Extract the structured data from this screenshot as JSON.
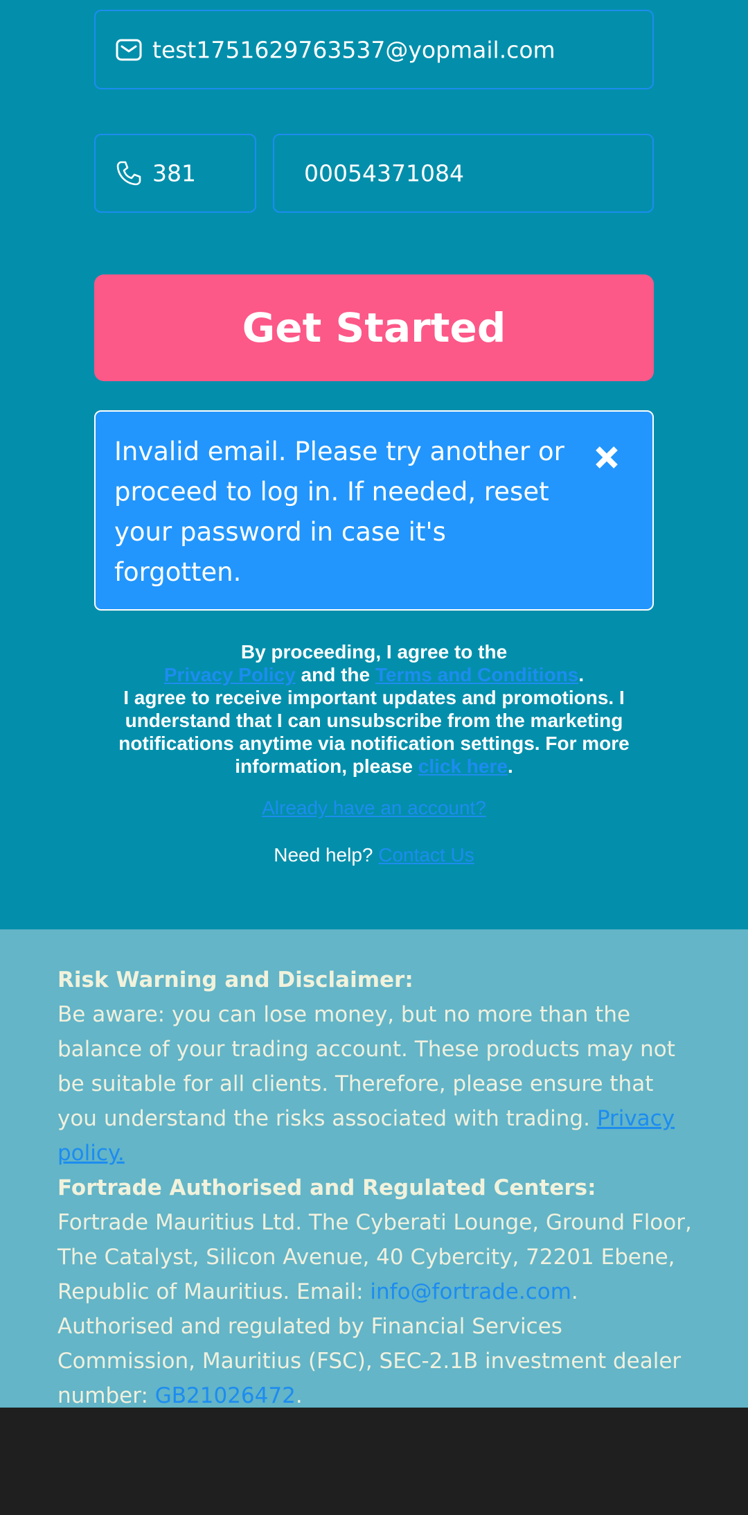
{
  "form": {
    "email_value": "test1751629763537@yopmail.com",
    "country_code": "381",
    "phone_value": "00054371084",
    "submit_label": "Get Started"
  },
  "error": {
    "message": "Invalid email. Please try another or proceed to log in. If needed, reset your password in case it's forgotten."
  },
  "legal": {
    "line1": "By proceeding, I agree to the",
    "privacy_link": "Privacy Policy",
    "and_the": "and the",
    "terms_link": "Terms and Conditions",
    "period": ".",
    "consent": "I agree to receive important updates and promotions. I understand that I can unsubscribe from the marketing notifications anytime via notification settings. For more information, please",
    "click_here": "click here"
  },
  "links": {
    "already_account": "Already have an account?",
    "need_help": "Need help?",
    "contact_us": "Contact Us"
  },
  "footer": {
    "risk_title": "Risk Warning and Disclaimer:",
    "risk_text": "Be aware: you can lose money, but no more than the balance of your trading account. These products may not be suitable for all clients. Therefore, please ensure that you understand the risks associated with trading.",
    "privacy_link": "Privacy policy.",
    "centers_title": "Fortrade Authorised and Regulated Centers:",
    "centers_text": "Fortrade Mauritius Ltd. The Cyberati Lounge, Ground Floor, The Catalyst, Silicon Avenue, 40 Cybercity, 72201 Ebene, Republic of Mauritius. Email:",
    "email": "info@fortrade.com",
    "authorised_text": "Authorised and regulated by Financial Services Commission, Mauritius (FSC), SEC-2.1B investment dealer number:",
    "dealer_number": "GB21026472"
  },
  "colors": {
    "page_bg": "#038fab",
    "button": "#fc5888",
    "error_bg": "#2296fc",
    "link": "#1d8cf0",
    "footer_bg": "#63b5c7",
    "bottom_bar": "#1f1f1f"
  },
  "icons": {
    "email": "envelope-icon",
    "phone": "phone-icon",
    "close": "close-icon"
  }
}
